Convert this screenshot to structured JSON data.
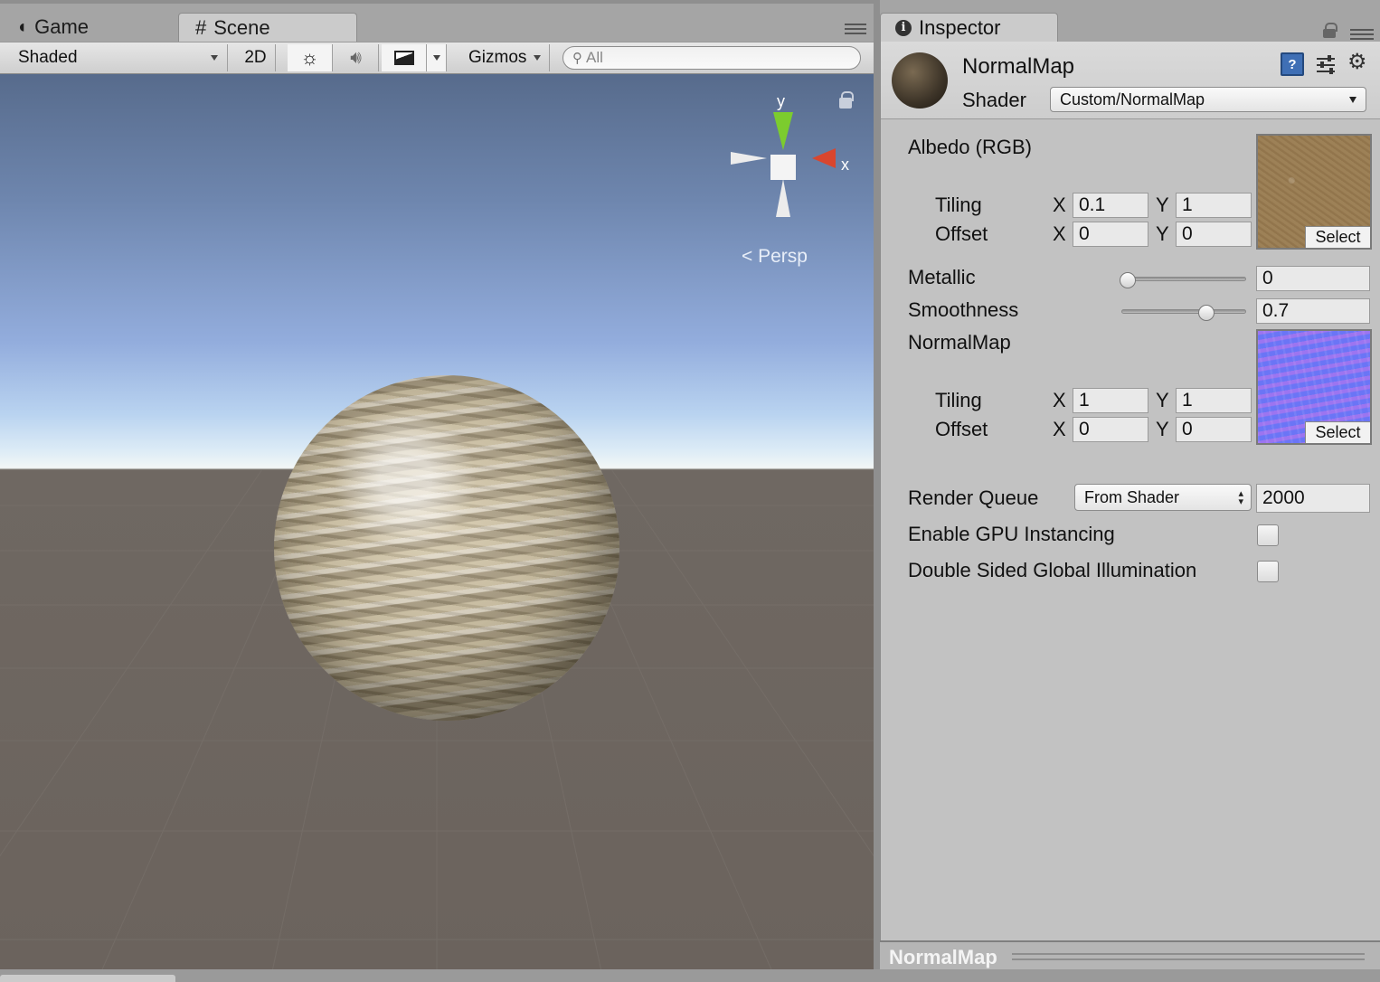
{
  "scene_window": {
    "tabs": [
      {
        "label": "Game",
        "icon": "pacman-icon"
      },
      {
        "label": "Scene",
        "icon": "grid-icon"
      }
    ],
    "toolbar": {
      "draw_mode": "Shaded",
      "mode_2d": "2D",
      "gizmos": "Gizmos",
      "search_placeholder": "All"
    },
    "viewport": {
      "projection_label": "Persp",
      "gizmo_axes": {
        "y": "y",
        "x": "x"
      },
      "colors": {
        "y_axis": "#7ccc2e",
        "x_axis": "#d9462e"
      }
    }
  },
  "inspector": {
    "tab_label": "Inspector",
    "material_name": "NormalMap",
    "shader_label": "Shader",
    "shader_value": "Custom/NormalMap",
    "properties": {
      "albedo": {
        "label": "Albedo (RGB)",
        "tiling_label": "Tiling",
        "offset_label": "Offset",
        "tiling_x": "0.1",
        "tiling_y": "1",
        "offset_x": "0",
        "offset_y": "0",
        "select_label": "Select"
      },
      "metallic": {
        "label": "Metallic",
        "value": "0",
        "slider_fraction": 0.0
      },
      "smoothness": {
        "label": "Smoothness",
        "value": "0.7",
        "slider_fraction": 0.7
      },
      "normalmap": {
        "label": "NormalMap",
        "tiling_label": "Tiling",
        "offset_label": "Offset",
        "tiling_x": "1",
        "tiling_y": "1",
        "offset_x": "0",
        "offset_y": "0",
        "select_label": "Select"
      },
      "axis_x": "X",
      "axis_y": "Y"
    },
    "render_queue": {
      "label": "Render Queue",
      "mode": "From Shader",
      "value": "2000"
    },
    "gpu_instancing": {
      "label": "Enable GPU Instancing",
      "checked": false
    },
    "double_sided_gi": {
      "label": "Double Sided Global Illumination",
      "checked": false
    },
    "footer_title": "NormalMap"
  }
}
